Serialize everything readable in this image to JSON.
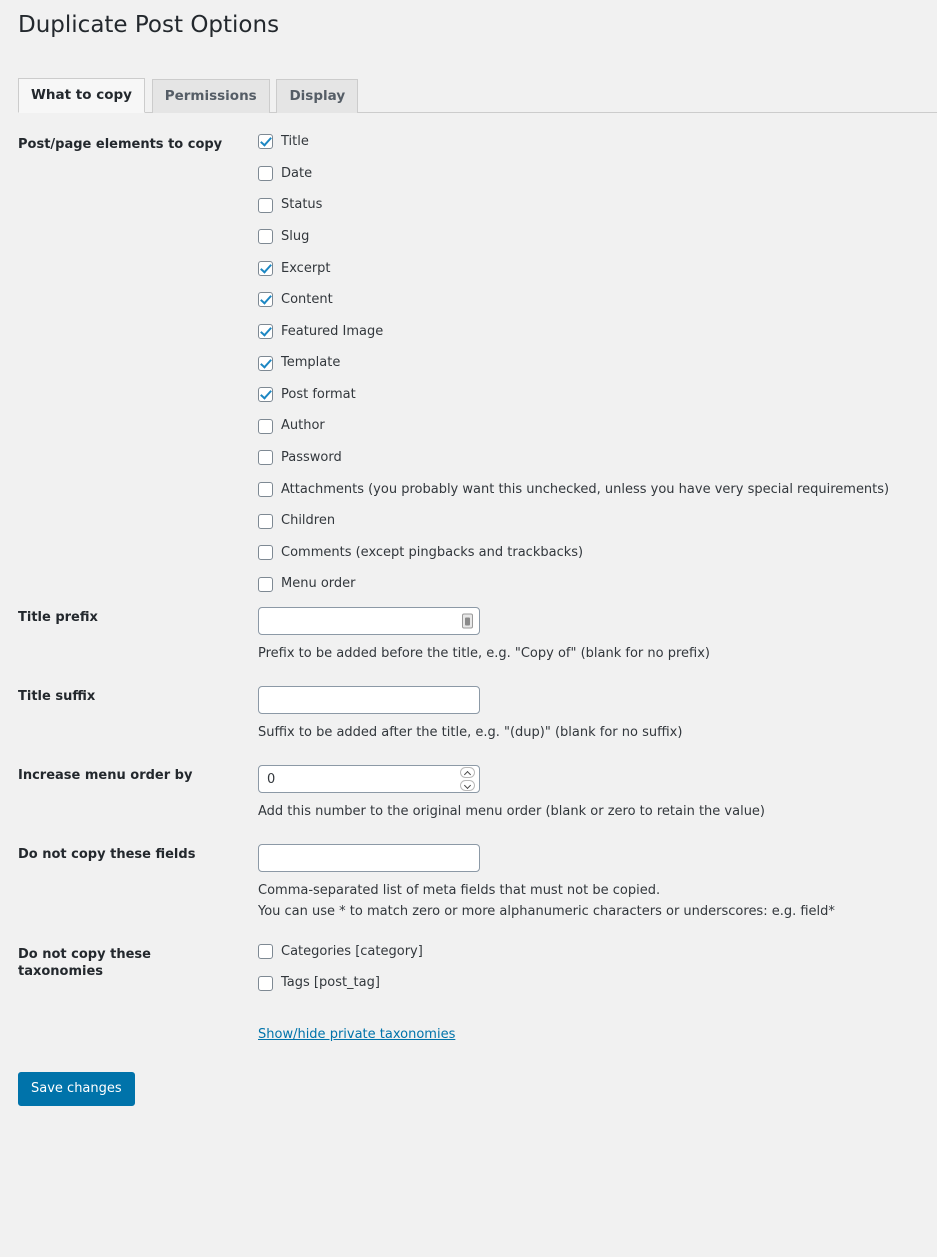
{
  "page": {
    "title": "Duplicate Post Options"
  },
  "tabs": [
    {
      "label": "What to copy",
      "active": true
    },
    {
      "label": "Permissions",
      "active": false
    },
    {
      "label": "Display",
      "active": false
    }
  ],
  "sections": {
    "elements": {
      "label": "Post/page elements to copy",
      "checkboxes": [
        {
          "label": "Title",
          "checked": true
        },
        {
          "label": "Date",
          "checked": false
        },
        {
          "label": "Status",
          "checked": false
        },
        {
          "label": "Slug",
          "checked": false
        },
        {
          "label": "Excerpt",
          "checked": true
        },
        {
          "label": "Content",
          "checked": true
        },
        {
          "label": "Featured Image",
          "checked": true
        },
        {
          "label": "Template",
          "checked": true
        },
        {
          "label": "Post format",
          "checked": true
        },
        {
          "label": "Author",
          "checked": false
        },
        {
          "label": "Password",
          "checked": false
        },
        {
          "label": "Attachments (you probably want this unchecked, unless you have very special requirements)",
          "checked": false
        },
        {
          "label": "Children",
          "checked": false
        },
        {
          "label": "Comments (except pingbacks and trackbacks)",
          "checked": false
        },
        {
          "label": "Menu order",
          "checked": false
        }
      ]
    },
    "title_prefix": {
      "label": "Title prefix",
      "value": "",
      "description": "Prefix to be added before the title, e.g. \"Copy of\" (blank for no prefix)",
      "icon": "autofill-icon"
    },
    "title_suffix": {
      "label": "Title suffix",
      "value": "",
      "description": "Suffix to be added after the title, e.g. \"(dup)\" (blank for no suffix)"
    },
    "menu_order": {
      "label": "Increase menu order by",
      "value": "0",
      "description": "Add this number to the original menu order (blank or zero to retain the value)"
    },
    "blacklist": {
      "label": "Do not copy these fields",
      "value": "",
      "description_line1": "Comma-separated list of meta fields that must not be copied.",
      "description_line2": "You can use * to match zero or more alphanumeric characters or underscores: e.g. field*"
    },
    "taxonomies": {
      "label": "Do not copy these taxonomies",
      "checkboxes": [
        {
          "label": "Categories [category]",
          "checked": false
        },
        {
          "label": "Tags [post_tag]",
          "checked": false
        }
      ],
      "link": "Show/hide private taxonomies"
    }
  },
  "submit": {
    "label": "Save changes"
  },
  "colors": {
    "accent": "#0073aa",
    "background": "#f1f1f1",
    "checkmark": "#1c87c3",
    "link": "#0073aa"
  }
}
